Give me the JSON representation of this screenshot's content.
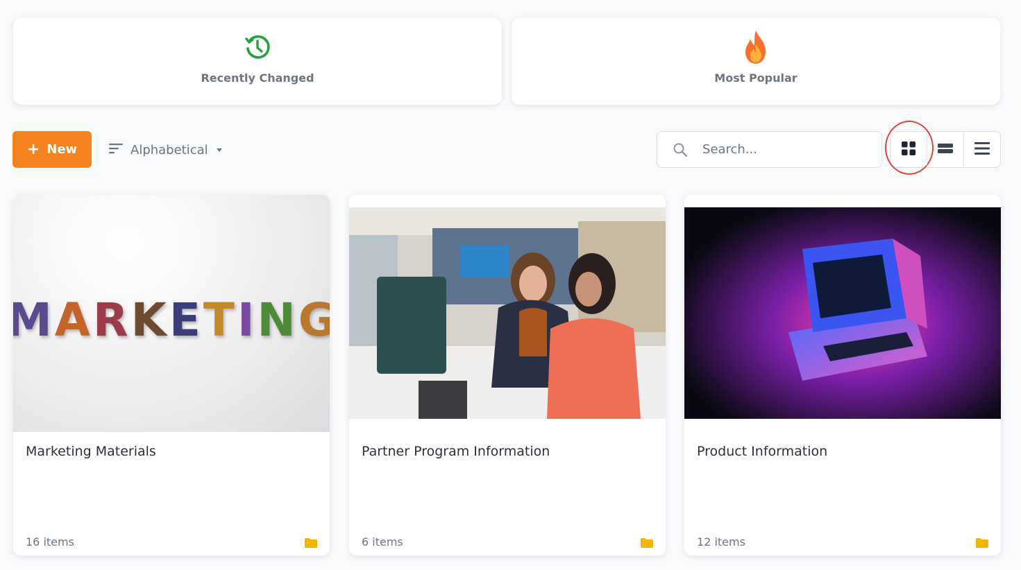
{
  "quick_filters": [
    {
      "label": "Recently Changed",
      "icon": "clock-history-icon",
      "color": "#22a33a"
    },
    {
      "label": "Most Popular",
      "icon": "fire-icon",
      "color": "#f26a2a"
    }
  ],
  "toolbar": {
    "new_label": "New",
    "sort_label": "Alphabetical",
    "search_placeholder": "Search...",
    "views": [
      "grid-view-icon",
      "card-view-icon",
      "list-view-icon"
    ],
    "active_view": "grid",
    "accent": "#f5841f"
  },
  "folders": [
    {
      "title": "Marketing Materials",
      "count": "16 items",
      "image_text": "MARKETING"
    },
    {
      "title": "Partner Program Information",
      "count": "6 items"
    },
    {
      "title": "Product Information",
      "count": "12 items"
    }
  ]
}
